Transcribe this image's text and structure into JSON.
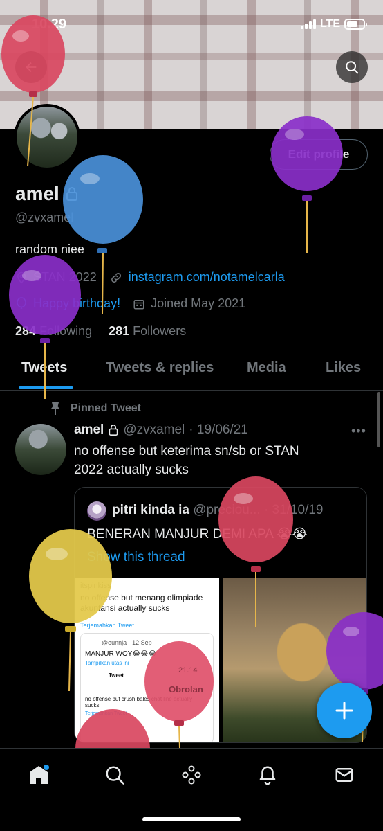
{
  "status_bar": {
    "time": "10.29",
    "network": "LTE"
  },
  "profile": {
    "name": "amel",
    "handle": "@zvxamel",
    "bio": "random niee",
    "location": "STAN 2022",
    "website": "instagram.com/notamelcarla",
    "birthday": "Happy birthday!",
    "joined": "Joined May 2021",
    "following_count": "284",
    "following_label": "Following",
    "followers_count": "281",
    "followers_label": "Followers",
    "edit_profile_label": "Edit profile"
  },
  "tabs": [
    {
      "label": "Tweets",
      "active": true
    },
    {
      "label": "Tweets & replies",
      "active": false
    },
    {
      "label": "Media",
      "active": false
    },
    {
      "label": "Likes",
      "active": false
    }
  ],
  "pinned_tweet": {
    "pinned_label": "Pinned Tweet",
    "author": "amel",
    "handle": "@zvxamel",
    "date": "· 19/06/21",
    "text_line1": "no offense but keterima sn/sb or STAN",
    "text_line2": "2022 actually sucks",
    "quote": {
      "author": "pitri kinda ia",
      "handle": "@preciou...",
      "date": "· 31/10/19",
      "text": "BENERAN MANJUR DEMI APA 😭😭",
      "thread_link": "Show this thread",
      "img1": {
        "user": "itspinkiss",
        "text": "no offense but menang olimpiade akuntansi actually sucks",
        "translate": "Terjemahkan Tweet",
        "inner_user": "@eunnja · 12 Sep",
        "inner_text": "MANJUR WOY😂😂😂",
        "inner_link": "Tampilkan utas ini",
        "inner_header": "Tweet",
        "inner_body": "no offense but crush bales chat line actually sucks",
        "inner_translate": "Terjemahkan Tweet"
      }
    }
  },
  "balloon_overlay": {
    "time": "21.14",
    "word": "Obrolan"
  },
  "colors": {
    "accent": "#1d9bf0",
    "background": "#000000",
    "muted": "#71767b"
  }
}
